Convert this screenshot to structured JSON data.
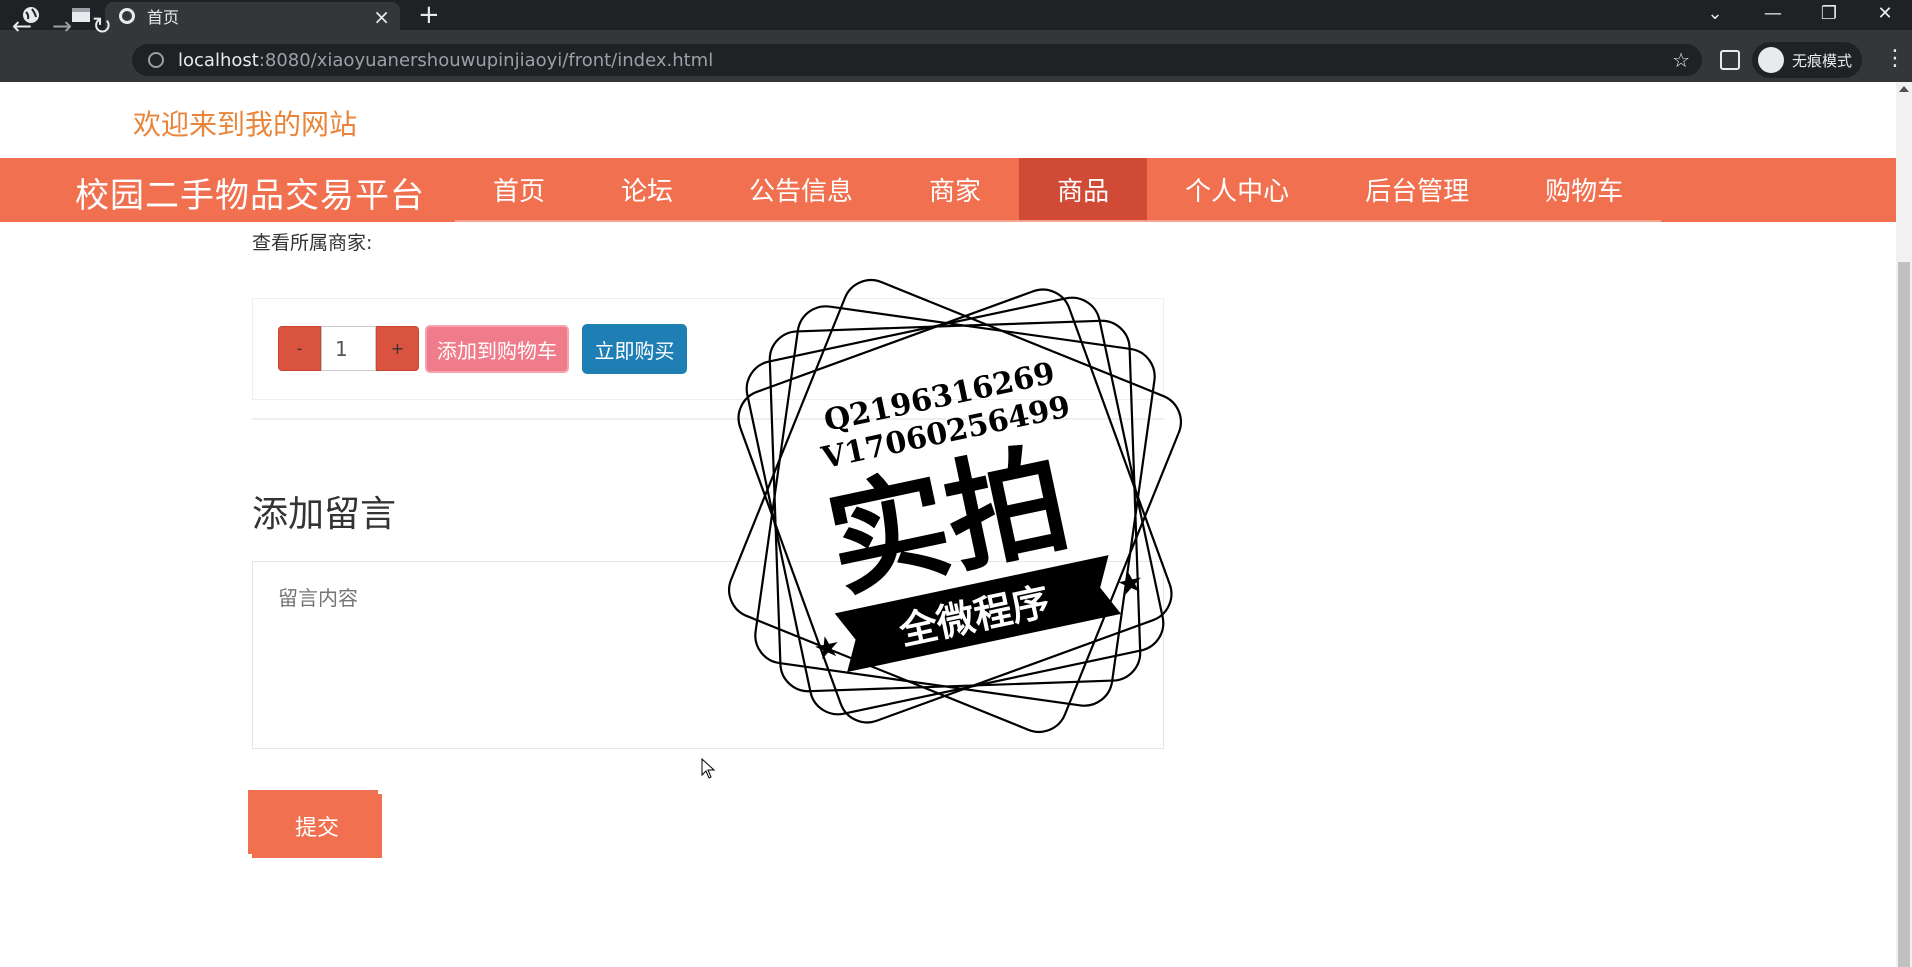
{
  "browser": {
    "tab_title": "首页",
    "url_host": "localhost",
    "url_rest": ":8080/xiaoyuanershouwupinjiaoyi/front/index.html",
    "incognito_label": "无痕模式"
  },
  "page": {
    "welcome": "欢迎来到我的网站",
    "logo": "校园二手物品交易平台",
    "nav": [
      {
        "label": "首页"
      },
      {
        "label": "论坛"
      },
      {
        "label": "公告信息"
      },
      {
        "label": "商家"
      },
      {
        "label": "商品"
      },
      {
        "label": "个人中心"
      },
      {
        "label": "后台管理"
      },
      {
        "label": "购物车"
      }
    ],
    "active_nav": "商品",
    "shop_link": "查看所属商家:",
    "quantity": {
      "minus": "-",
      "value": "1",
      "plus": "+"
    },
    "add_to_cart": "添加到购物车",
    "buy_now": "立即购买",
    "comment_title": "添加留言",
    "comment_placeholder": "留言内容",
    "submit": "提交"
  },
  "watermark": {
    "line1": "Q2196316269",
    "line2": "V17060256499",
    "big": "实拍",
    "banner": "全微程序"
  },
  "colors": {
    "nav_bg": "#f07050",
    "nav_active": "#d04a35",
    "welcome": "#e8853b",
    "buy_now": "#1f7fb5",
    "add_cart": "#f07b8a"
  }
}
